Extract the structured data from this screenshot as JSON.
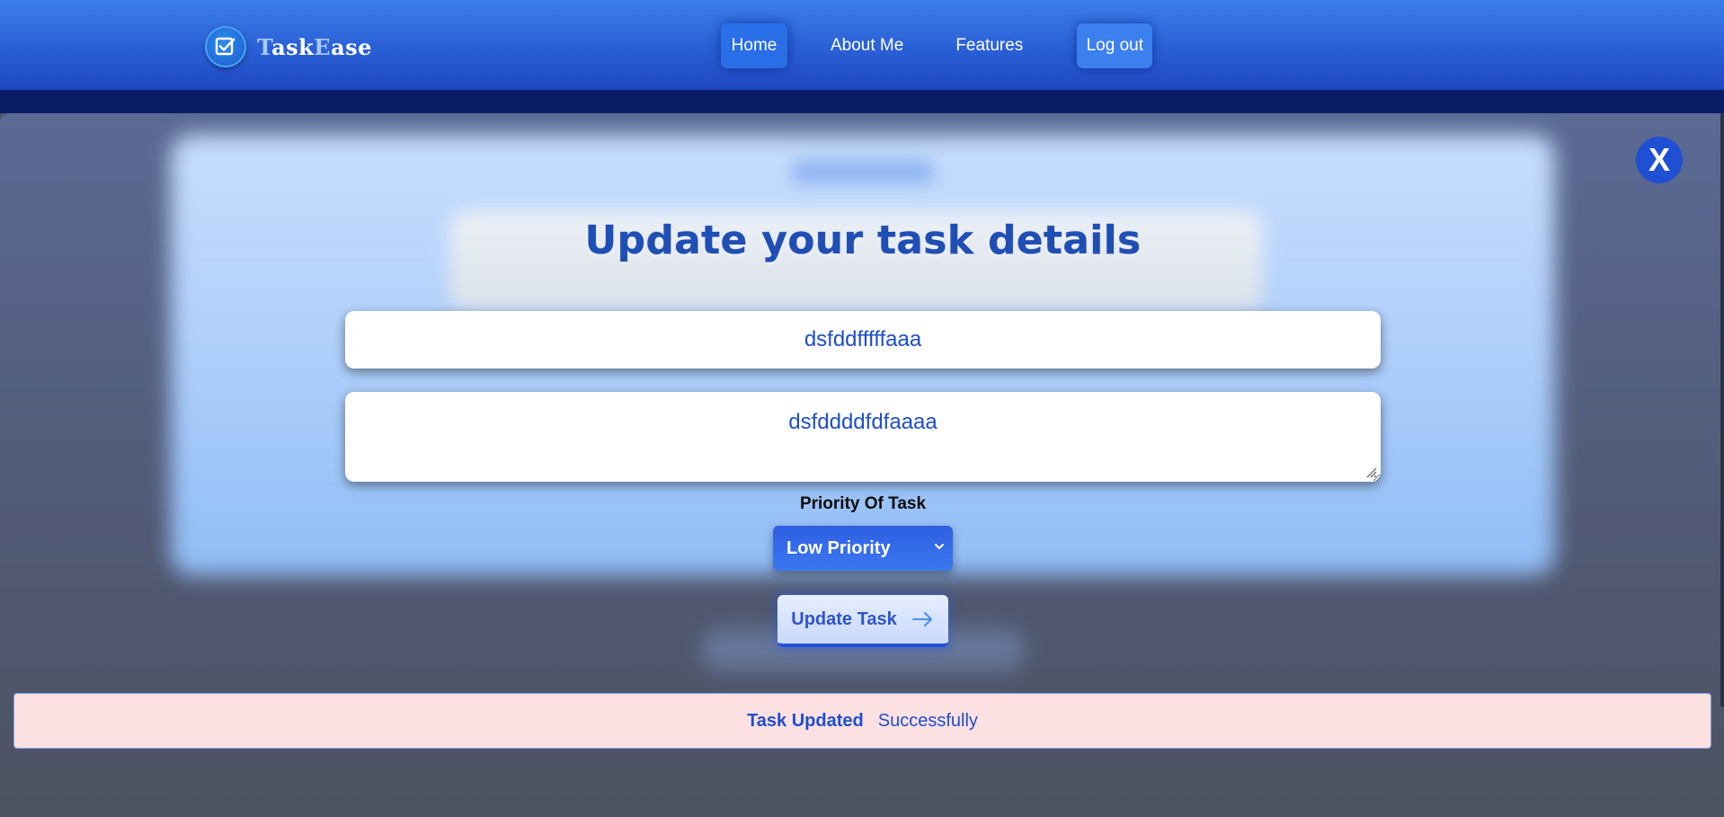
{
  "brand": {
    "name_first_letter": "T",
    "name_part1": "ask",
    "name_second_letter": "E",
    "name_part2": "ase",
    "logo_icon": "checkbox-icon"
  },
  "nav": {
    "items": [
      {
        "label": "Home",
        "active": true
      },
      {
        "label": "About Me"
      },
      {
        "label": "Features"
      },
      {
        "label": "Log out"
      }
    ]
  },
  "modal": {
    "close_label": "X",
    "title": "Update your task details",
    "task_title_value": "dsfddfffffaaa",
    "task_description_value": "dsfddddfdfaaaa",
    "priority_label": "Priority Of Task",
    "priority_selected": "Low Priority",
    "update_button_label": "Update Task",
    "update_button_icon": "arrow-right-icon"
  },
  "alert": {
    "strong_text": "Task Updated",
    "text": "Successfully"
  },
  "colors": {
    "nav_top": "#3c7fe9",
    "nav_bottom": "#1e47c1",
    "accent": "#1f4fd2",
    "text_blue": "#1e4fc9",
    "alert_bg": "#fde0e2"
  }
}
